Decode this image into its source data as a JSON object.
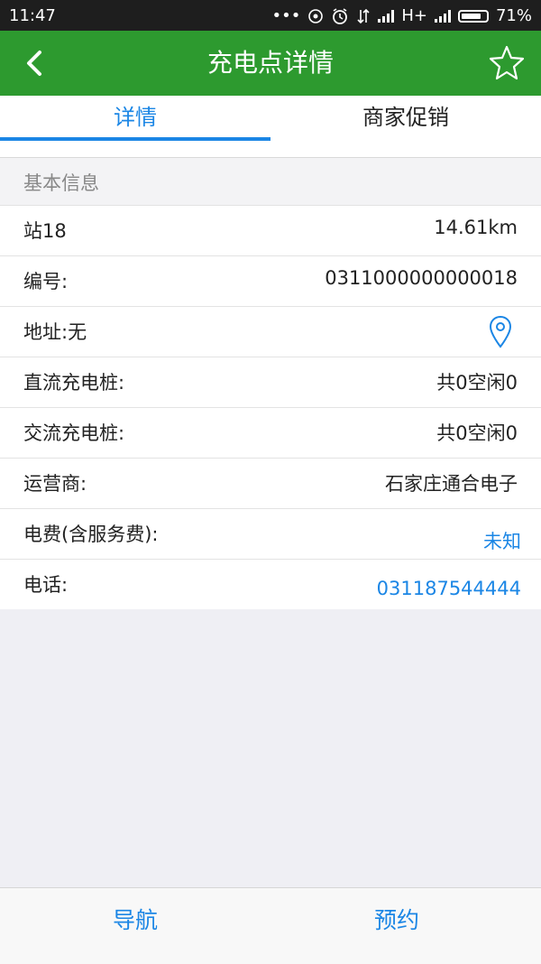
{
  "status_bar": {
    "time": "11:47",
    "dots": "•••",
    "network": "H+",
    "battery": "71%"
  },
  "header": {
    "title": "充电点详情",
    "back_icon": "chevron-left-icon",
    "favorite_icon": "star-outline-icon"
  },
  "tabs": [
    {
      "label": "详情",
      "active": true
    },
    {
      "label": "商家促销",
      "active": false
    }
  ],
  "section": {
    "title": "基本信息"
  },
  "details": {
    "station": {
      "label": "站18",
      "value": "14.61km"
    },
    "number": {
      "label": "编号:",
      "value": "0311000000000018"
    },
    "address": {
      "label": "地址:无",
      "icon": "location-pin-icon"
    },
    "dc": {
      "label": "直流充电桩:",
      "value": "共0空闲0"
    },
    "ac": {
      "label": "交流充电桩:",
      "value": "共0空闲0"
    },
    "operator": {
      "label": "运营商:",
      "value": "石家庄通合电子"
    },
    "fee": {
      "label": "电费(含服务费):",
      "value": "未知"
    },
    "phone": {
      "label": "电话:",
      "value": "031187544444"
    }
  },
  "bottom": {
    "navigate": "导航",
    "reserve": "预约"
  },
  "colors": {
    "header_green": "#2d9a2f",
    "accent_blue": "#1b86e5",
    "background": "#efeff4"
  }
}
